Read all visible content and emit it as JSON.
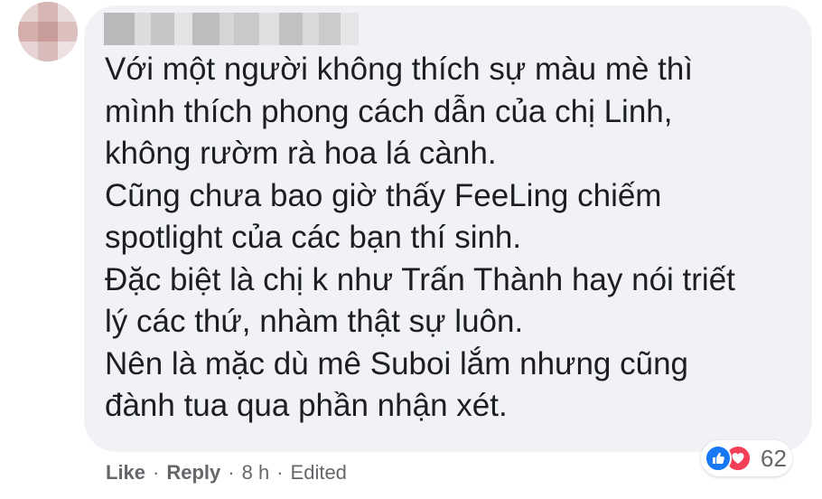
{
  "comment": {
    "lines": [
      "Với một người không thích sự màu mè thì",
      "mình thích phong cách dẫn của chị Linh,",
      "không rườm rà hoa lá cành.",
      "Cũng chưa bao giờ thấy FeeLing chiếm",
      "spotlight của các bạn thí sinh.",
      "Đặc biệt là chị k như Trấn Thành hay nói triết",
      "lý các thứ, nhàm thật sự luôn.",
      "Nên là mặc dù mê Suboi lắm nhưng cũng",
      "đành tua qua phần nhận xét."
    ]
  },
  "reactions": {
    "count": "62",
    "types": [
      "like-icon",
      "love-icon"
    ],
    "like_color": "#1877f2",
    "love_color": "#f33e58"
  },
  "actions": {
    "like": "Like",
    "reply": "Reply",
    "separator": "·",
    "time": "8 h",
    "edited": "Edited"
  },
  "colors": {
    "bubble": "#f0f2f5",
    "text": "#1c1e21",
    "meta": "#65676b"
  }
}
